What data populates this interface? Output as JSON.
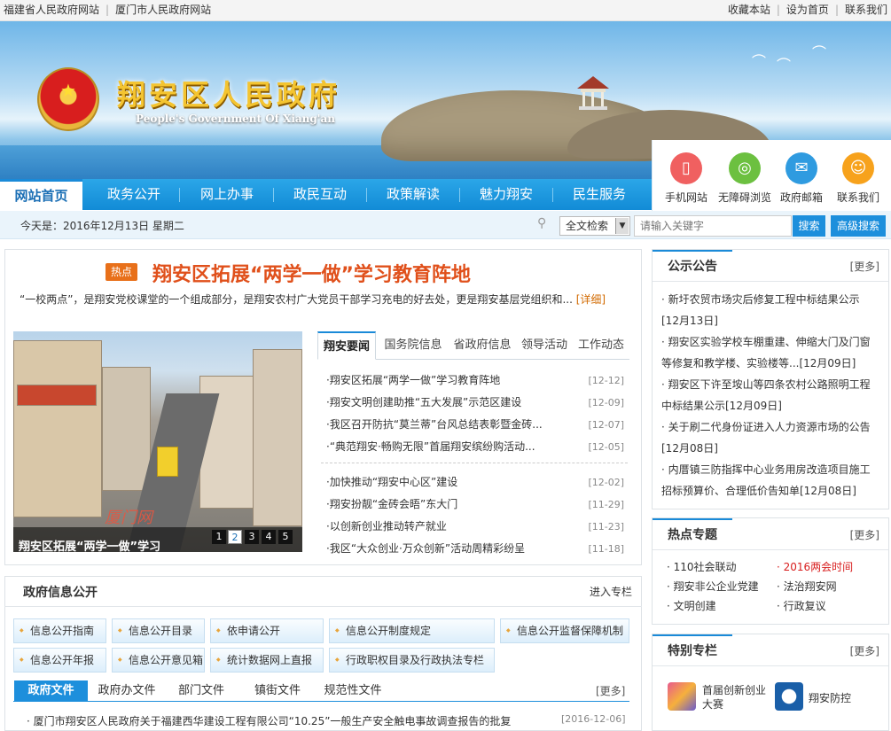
{
  "topbar": {
    "left_links": [
      "福建省人民政府网站",
      "厦门市人民政府网站"
    ],
    "right_links": [
      "收藏本站",
      "设为首页",
      "联系我们"
    ]
  },
  "header": {
    "title": "翔安区人民政府",
    "subtitle": "People's Government Of Xiang'an"
  },
  "nav": {
    "items": [
      "网站首页",
      "政务公开",
      "网上办事",
      "政民互动",
      "政策解读",
      "魅力翔安",
      "民生服务"
    ]
  },
  "quick_links": [
    {
      "label": "手机网站",
      "icon": "mobile-icon",
      "color": "#f06060"
    },
    {
      "label": "无障碍浏览",
      "icon": "accessibility-icon",
      "color": "#6cc040"
    },
    {
      "label": "政府邮箱",
      "icon": "mail-icon",
      "color": "#2f9be0"
    },
    {
      "label": "联系我们",
      "icon": "contact-icon",
      "color": "#f7a21c"
    }
  ],
  "datebar": {
    "date": "今天是：2016年12月13日 星期二"
  },
  "search": {
    "scope": "全文检索",
    "placeholder": "请输入关键字",
    "search_label": "搜索",
    "advanced_label": "高级搜索"
  },
  "headline": {
    "badge": "热点",
    "title": "翔安区拓展“两学一做”学习教育阵地",
    "summary": "“一校两点”，是翔安党校课堂的一个组成部分，是翔安农村广大党员干部学习充电的好去处，更是翔安基层党组织和...",
    "more": "[详细]"
  },
  "slideshow": {
    "caption": "翔安区拓展“两学一做”学习",
    "watermark": "厦门网",
    "pages": [
      "1",
      "2",
      "3",
      "4",
      "5"
    ],
    "current": 2
  },
  "news": {
    "tabs": [
      "翔安要闻",
      "国务院信息",
      "省政府信息",
      "领导活动",
      "工作动态"
    ],
    "items": [
      {
        "title": "·翔安区拓展“两学一做”学习教育阵地",
        "date": "[12-12]"
      },
      {
        "title": "·翔安文明创建助推“五大发展”示范区建设",
        "date": "[12-09]"
      },
      {
        "title": "·我区召开防抗“莫兰蒂”台风总结表彰暨金砖...",
        "date": "[12-07]"
      },
      {
        "title": "·“典范翔安·畅购无限”首届翔安缤纷购活动...",
        "date": "[12-05]"
      },
      {
        "title": "·加快推动“翔安中心区”建设",
        "date": "[12-02]"
      },
      {
        "title": "·翔安扮靓“金砖会晤”东大门",
        "date": "[11-29]"
      },
      {
        "title": "·以创新创业推动转产就业",
        "date": "[11-23]"
      },
      {
        "title": "·我区“大众创业·万众创新”活动周精彩纷呈",
        "date": "[11-18]"
      }
    ]
  },
  "notices": {
    "title": "公示公告",
    "more": "[更多]",
    "items": [
      "· 新圩农贸市场灾后修复工程中标结果公示[12月13日]",
      "· 翔安区实验学校车棚重建、伸缩大门及门窗等修复和教学楼、实验楼等...[12月09日]",
      "· 翔安区下许至垵山等四条农村公路照明工程中标结果公示[12月09日]",
      "· 关于刷二代身份证进入人力资源市场的公告[12月08日]",
      "· 内厝镇三防指挥中心业务用房改造项目施工招标预算价、合理低价告知单[12月08日]"
    ]
  },
  "topics": {
    "title": "热点专题",
    "more": "[更多]",
    "items": [
      "· 110社会联动",
      "· 2016两会时间",
      "· 翔安非公企业党建",
      "· 法治翔安网",
      "· 文明创建",
      "· 行政复议"
    ],
    "highlight_color": "#d81e1e"
  },
  "special": {
    "title": "特别专栏",
    "more": "[更多]",
    "items": [
      "首届创新创业大赛",
      "翔安防控"
    ]
  },
  "gov_info": {
    "title": "政府信息公开",
    "more": "进入专栏",
    "buttons": [
      "信息公开指南",
      "信息公开目录",
      "依申请公开",
      "信息公开制度规定",
      "信息公开监督保障机制",
      "信息公开年报",
      "信息公开意见箱",
      "统计数据网上直报",
      "行政职权目录及行政执法专栏"
    ],
    "tabs": [
      "政府文件",
      "政府办文件",
      "部门文件",
      "镇街文件",
      "规范性文件"
    ],
    "tab_more": "[更多]",
    "doc": {
      "title": "· 厦门市翔安区人民政府关于福建西华建设工程有限公司“10.25”一般生产安全触电事故调查报告的批复",
      "date": "[2016-12-06]"
    }
  }
}
